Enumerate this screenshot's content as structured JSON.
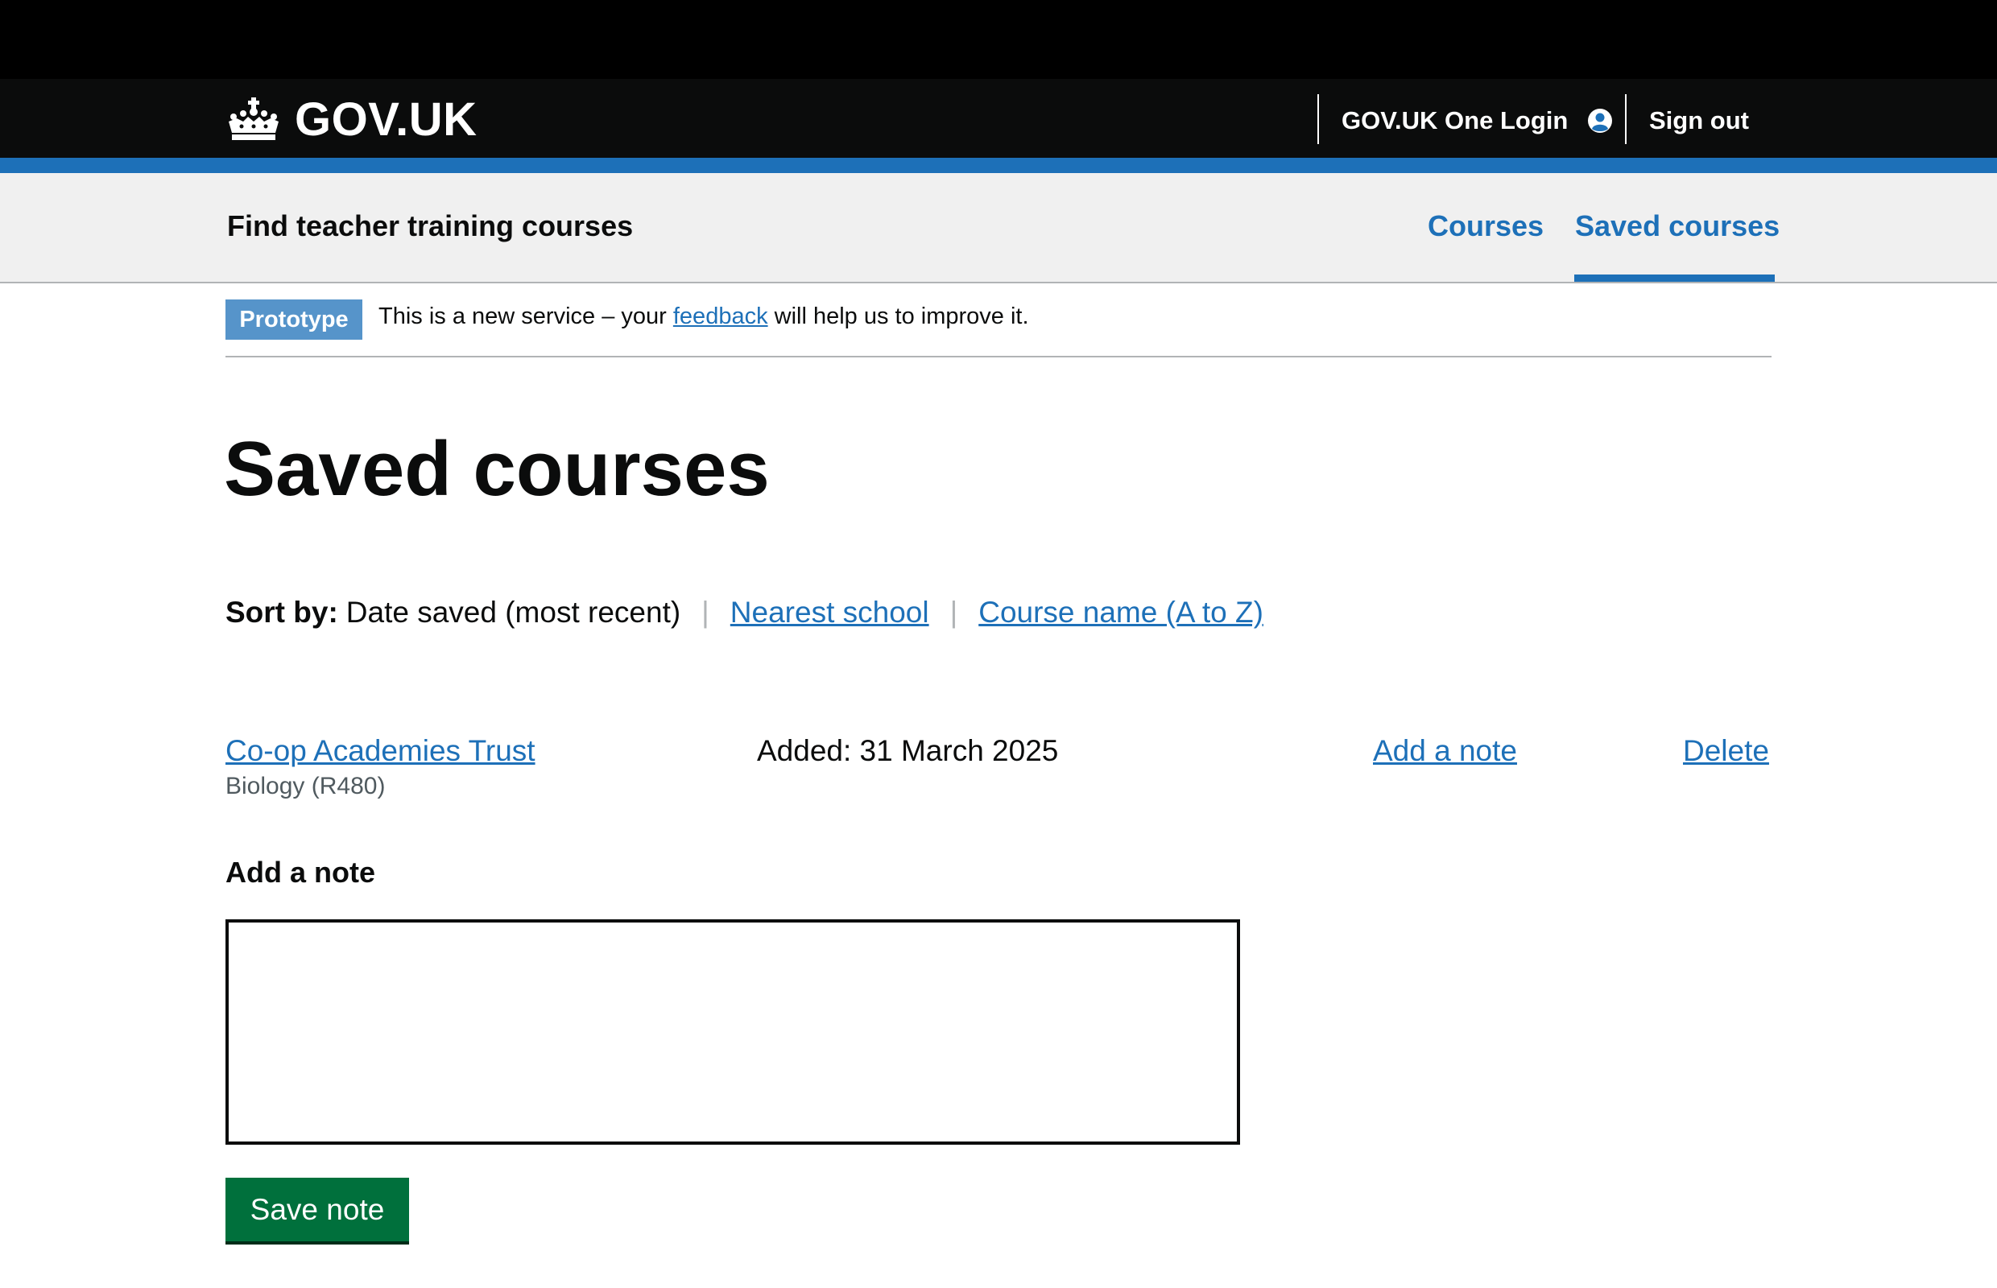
{
  "header": {
    "logo_text": "GOV.UK",
    "one_login_label": "GOV.UK One Login",
    "sign_out_label": "Sign out"
  },
  "service_nav": {
    "service_name": "Find teacher training courses",
    "items": [
      {
        "label": "Courses",
        "active": false
      },
      {
        "label": "Saved courses",
        "active": true
      }
    ]
  },
  "phase_banner": {
    "tag": "Prototype",
    "text_before": "This is a new service – your",
    "link_text": "feedback",
    "text_after": "will help us to improve it."
  },
  "page": {
    "title": "Saved courses"
  },
  "sort": {
    "label": "Sort by:",
    "current": "Date saved (most recent)",
    "options": [
      "Nearest school",
      "Course name (A to Z)"
    ]
  },
  "saved_courses": [
    {
      "provider": "Co-op Academies Trust",
      "course": "Biology (R480)",
      "added": "Added: 31 March 2025",
      "add_note_label": "Add a note",
      "delete_label": "Delete"
    }
  ],
  "note_form": {
    "label": "Add a note",
    "value": "",
    "button_label": "Save note"
  },
  "colors": {
    "header_bg": "#0b0c0c",
    "brand_blue": "#1d70b8",
    "phase_tag": "#5694ca",
    "button_green": "#00703c",
    "nav_bg": "#f0f0f0"
  }
}
